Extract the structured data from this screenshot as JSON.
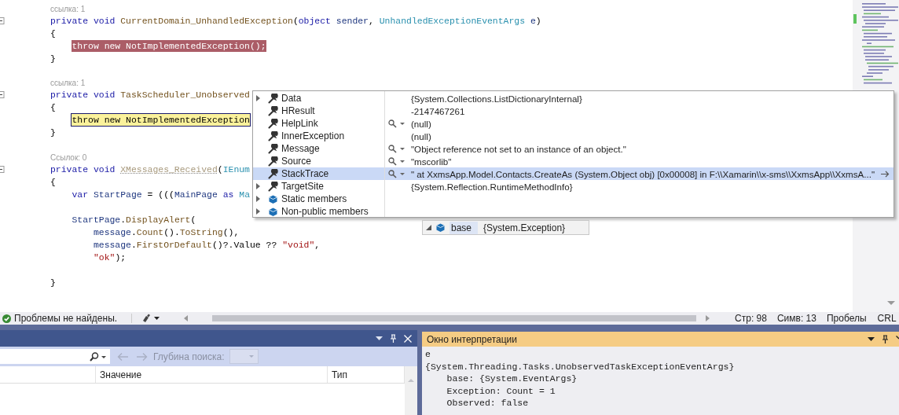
{
  "editor": {
    "lines": [
      {
        "kind": "codelens",
        "text": "ссылка: 1"
      },
      {
        "kind": "code",
        "tokens": [
          {
            "t": "private void ",
            "kind": "keyword"
          },
          {
            "t": "CurrentDomain_UnhandledException",
            "kind": "method"
          },
          {
            "t": "(",
            "kind": "plain"
          },
          {
            "t": "object ",
            "kind": "keyword"
          },
          {
            "t": "sender",
            "kind": "variable"
          },
          {
            "t": ", ",
            "kind": "plain"
          },
          {
            "t": "UnhandledExceptionEventArgs ",
            "kind": "type"
          },
          {
            "t": "e",
            "kind": "variable"
          },
          {
            "t": ")",
            "kind": "plain"
          }
        ]
      },
      {
        "kind": "code",
        "tokens": [
          {
            "t": "{",
            "kind": "plain"
          }
        ],
        "children": [
          {
            "kind": "code",
            "tokens": [
              {
                "t": "throw new NotImplementedException();",
                "kind": "breakpoint"
              }
            ]
          }
        ]
      },
      {
        "kind": "code",
        "tokens": [
          {
            "t": "}",
            "kind": "plain"
          }
        ]
      },
      {
        "kind": "blank"
      },
      {
        "kind": "codelens",
        "text": "ссылка: 1"
      },
      {
        "kind": "code",
        "tokens": [
          {
            "t": "private void ",
            "kind": "keyword"
          },
          {
            "t": "TaskScheduler_Unobserved",
            "kind": "method"
          }
        ]
      },
      {
        "kind": "code",
        "tokens": [
          {
            "t": "{",
            "kind": "plain"
          }
        ],
        "children": [
          {
            "kind": "code",
            "tokens": [
              {
                "t": "throw new NotImplementedException",
                "kind": "current"
              }
            ]
          }
        ]
      },
      {
        "kind": "code",
        "tokens": [
          {
            "t": "}",
            "kind": "plain"
          }
        ]
      },
      {
        "kind": "blank"
      },
      {
        "kind": "codelens",
        "text": "Ссылок: 0"
      },
      {
        "kind": "code",
        "tokens": [
          {
            "t": "private void ",
            "kind": "keyword"
          },
          {
            "t": "XMessages_Received",
            "kind": "unused"
          },
          {
            "t": "(",
            "kind": "plain"
          },
          {
            "t": "IEnum",
            "kind": "type"
          }
        ]
      },
      {
        "kind": "code",
        "tokens": [
          {
            "t": "{",
            "kind": "plain"
          }
        ],
        "children": [
          {
            "kind": "code",
            "tokens": [
              {
                "t": "var ",
                "kind": "keyword"
              },
              {
                "t": "StartPage",
                "kind": "variable"
              },
              {
                "t": " = (((",
                "kind": "plain"
              },
              {
                "t": "MainPage ",
                "kind": "variable"
              },
              {
                "t": "as ",
                "kind": "keyword"
              },
              {
                "t": "Ma",
                "kind": "type"
              }
            ]
          },
          {
            "kind": "blank"
          },
          {
            "kind": "code",
            "tokens": [
              {
                "t": "StartPage",
                "kind": "variable"
              },
              {
                "t": ".",
                "kind": "plain"
              },
              {
                "t": "DisplayAlert",
                "kind": "method"
              },
              {
                "t": "(",
                "kind": "plain"
              }
            ],
            "children": [
              {
                "kind": "code",
                "tokens": [
                  {
                    "t": "message",
                    "kind": "variable"
                  },
                  {
                    "t": ".",
                    "kind": "plain"
                  },
                  {
                    "t": "Count",
                    "kind": "method"
                  },
                  {
                    "t": "().",
                    "kind": "plain"
                  },
                  {
                    "t": "ToString",
                    "kind": "method"
                  },
                  {
                    "t": "(),",
                    "kind": "plain"
                  }
                ]
              },
              {
                "kind": "code",
                "tokens": [
                  {
                    "t": "message",
                    "kind": "variable"
                  },
                  {
                    "t": ".",
                    "kind": "plain"
                  },
                  {
                    "t": "FirstOrDefault",
                    "kind": "method"
                  },
                  {
                    "t": "()?.Value ?? ",
                    "kind": "plain"
                  },
                  {
                    "t": "\"void\"",
                    "kind": "string"
                  },
                  {
                    "t": ",",
                    "kind": "plain"
                  }
                ]
              },
              {
                "kind": "code",
                "tokens": [
                  {
                    "t": "\"ok\"",
                    "kind": "string"
                  },
                  {
                    "t": ");",
                    "kind": "plain"
                  }
                ]
              }
            ]
          },
          {
            "kind": "blank"
          }
        ]
      },
      {
        "kind": "code",
        "tokens": [
          {
            "t": "}",
            "kind": "plain"
          }
        ]
      }
    ]
  },
  "datatip": {
    "rows": [
      {
        "name": "Data",
        "value": "{System.Collections.ListDictionaryInternal}",
        "kind": "property",
        "expandable": true,
        "visualizer": false,
        "selected": false,
        "pin": false
      },
      {
        "name": "HResult",
        "value": "-2147467261",
        "kind": "property",
        "expandable": false,
        "visualizer": false,
        "selected": false,
        "pin": false
      },
      {
        "name": "HelpLink",
        "value": "(null)",
        "kind": "property",
        "expandable": false,
        "visualizer": true,
        "selected": false,
        "pin": false
      },
      {
        "name": "InnerException",
        "value": "(null)",
        "kind": "property",
        "expandable": false,
        "visualizer": false,
        "selected": false,
        "pin": false
      },
      {
        "name": "Message",
        "value": "\"Object reference not set to an instance of an object.\"",
        "kind": "property",
        "expandable": false,
        "visualizer": true,
        "selected": false,
        "pin": false
      },
      {
        "name": "Source",
        "value": "\"mscorlib\"",
        "kind": "property",
        "expandable": false,
        "visualizer": true,
        "selected": false,
        "pin": false
      },
      {
        "name": "StackTrace",
        "value": "\"  at XxmsApp.Model.Contacts.CreateAs (System.Object obj) [0x00008] in F:\\\\Xamarin\\\\x-sms\\\\XxmsApp\\\\XxmsA...\"",
        "kind": "property",
        "expandable": false,
        "visualizer": true,
        "selected": true,
        "pin": true
      },
      {
        "name": "TargetSite",
        "value": "{System.Reflection.RuntimeMethodInfo}",
        "kind": "property",
        "expandable": true,
        "visualizer": false,
        "selected": false,
        "pin": false
      },
      {
        "name": "Static members",
        "kind": "group",
        "expandable": true,
        "visualizer": false,
        "selected": false,
        "pin": false
      },
      {
        "name": "Non-public members",
        "kind": "group",
        "expandable": true,
        "visualizer": false,
        "selected": false,
        "pin": false
      }
    ],
    "parent": {
      "name": "base",
      "value": "{System.Exception}",
      "expanded": true
    }
  },
  "status_bar": {
    "issues": "Проблемы не найдены.",
    "line": "Стр: 98",
    "column": "Симв: 13",
    "indent": "Пробелы",
    "eol": "CRL"
  },
  "locals_panel": {
    "depth_label": "Глубина поиска:",
    "columns": [
      {
        "label": "Значение"
      },
      {
        "label": "Тип"
      }
    ]
  },
  "immediate_window": {
    "title": "Окно интерпретации",
    "output": [
      {
        "text": "e"
      },
      {
        "text": "{System.Threading.Tasks.UnobservedTaskExceptionEventArgs}",
        "children": [
          {
            "text": "base: {System.EventArgs}"
          },
          {
            "text": "Exception: Count = 1"
          },
          {
            "text": "Observed: false"
          }
        ]
      }
    ]
  }
}
